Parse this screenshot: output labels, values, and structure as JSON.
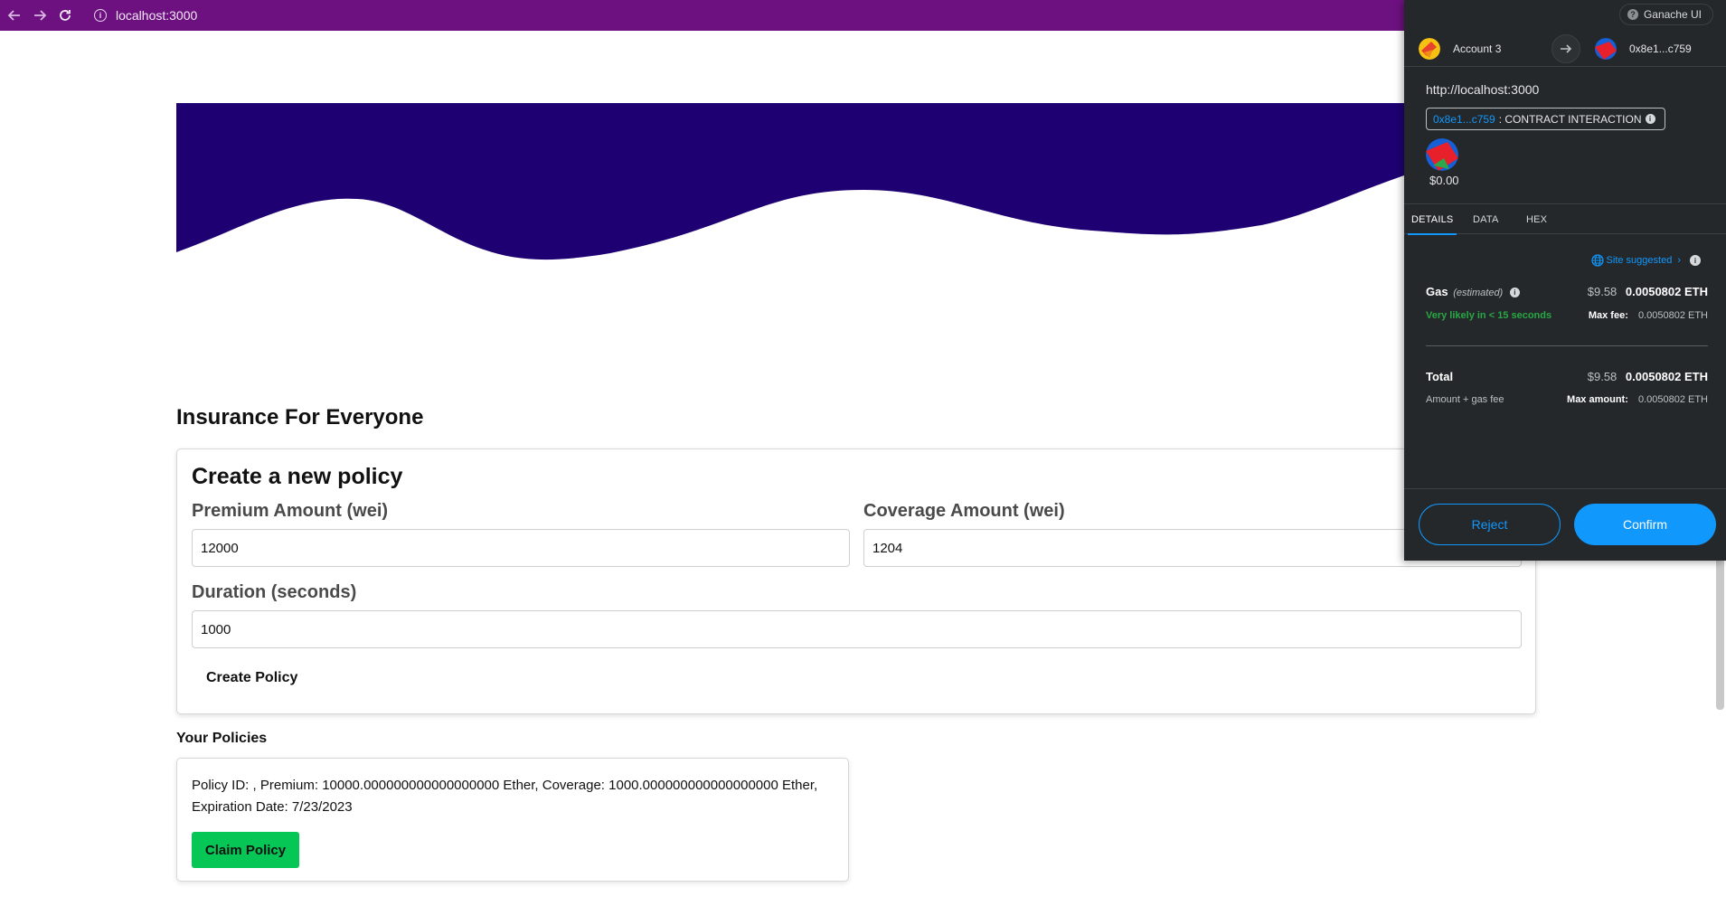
{
  "browser": {
    "url": "localhost:3000"
  },
  "colors": {
    "toolbar": "#6d1180",
    "hero": "#1e0073",
    "claim_button": "#06c756",
    "metamask_bg": "#25282b",
    "metamask_accent": "#1098fc"
  },
  "page": {
    "app_title": "Insurance For Everyone",
    "form": {
      "title": "Create a new policy",
      "premium_label": "Premium Amount (wei)",
      "premium_value": "12000",
      "coverage_label": "Coverage Amount (wei)",
      "coverage_value": "1204",
      "duration_label": "Duration (seconds)",
      "duration_value": "1000",
      "create_button": "Create Policy"
    },
    "policies_title": "Your Policies",
    "policies": [
      {
        "text": "Policy ID: , Premium: 10000.000000000000000000 Ether, Coverage: 1000.000000000000000000 Ether, Expiration Date: 7/23/2023",
        "claim_button": "Claim Policy"
      }
    ]
  },
  "metamask": {
    "network": "Ganache UI",
    "from_account": "Account 3",
    "to_address": "0x8e1...c759",
    "origin": "http://localhost:3000",
    "contract_address": "0x8e1...c759",
    "contract_label": ": CONTRACT INTERACTION",
    "value_usd": "$0.00",
    "tabs": [
      "DETAILS",
      "DATA",
      "HEX"
    ],
    "active_tab": "DETAILS",
    "site_suggested": "Site suggested",
    "gas": {
      "label": "Gas",
      "estimated": "(estimated)",
      "usd": "$9.58",
      "eth": "0.0050802 ETH",
      "likely": "Very likely in < 15 seconds",
      "max_fee_label": "Max fee:",
      "max_fee_value": "0.0050802 ETH"
    },
    "total": {
      "label": "Total",
      "usd": "$9.58",
      "eth": "0.0050802 ETH",
      "sub_label": "Amount + gas fee",
      "max_amount_label": "Max amount:",
      "max_amount_value": "0.0050802 ETH"
    },
    "reject_button": "Reject",
    "confirm_button": "Confirm"
  }
}
